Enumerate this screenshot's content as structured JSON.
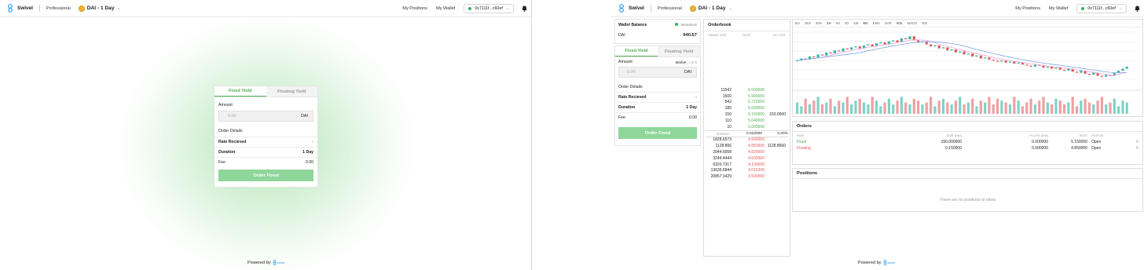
{
  "header": {
    "brand": "Swivel",
    "mode": "Professional",
    "pair": "DAI - 1 Day",
    "nav_positions": "My Positions",
    "nav_wallet": "My Wallet",
    "address": "0x7111f...c60ef"
  },
  "left_card": {
    "tab_fixed": "Fixed Yield",
    "tab_floating": "Floating Yield",
    "amount_label": "Amount",
    "amount_placeholder": "0.00",
    "amount_unit": "DAI",
    "order_details": "Order Details",
    "rate_label": "Rate Recieved",
    "rate_value": "-",
    "duration_label": "Duration",
    "duration_value": "1 Day",
    "fee_label": "Fee",
    "fee_value": "0.00",
    "button": "Order Fixed"
  },
  "powered_by": "Powered by",
  "powered_brand": "swivel",
  "wallet": {
    "title": "Wallet Balance",
    "provider": "MetaMask",
    "token": "DAI",
    "balance": "940.67"
  },
  "right_card": {
    "tab_fixed": "Fixed Yield",
    "tab_floating": "Floating Yield",
    "amount_label": "Amount",
    "market": "Market",
    "limit": "Limit",
    "amount_placeholder": "0.00",
    "amount_unit": "DAI",
    "order_details": "Order Details",
    "rate_label": "Rate Recieved",
    "rate_value": "-",
    "duration_label": "Duration",
    "duration_value": "1 Day",
    "fee_label": "Fee",
    "fee_value": "0.00",
    "button": "Order Fixed"
  },
  "orderbook": {
    "title": "Orderbook",
    "headers": [
      "TRADE SIZE",
      "RATE",
      "MY SIZE"
    ],
    "bids": [
      {
        "size": "11542",
        "rate": "6.500000",
        "mine": ""
      },
      {
        "size": "1500",
        "rate": "5.990000",
        "mine": ""
      },
      {
        "size": "842",
        "rate": "5.712000",
        "mine": ""
      },
      {
        "size": "185",
        "rate": "5.500000",
        "mine": ""
      },
      {
        "size": "150",
        "rate": "5.150000",
        "mine": "150.0000"
      },
      {
        "size": "110",
        "rate": "5.040000",
        "mine": ""
      },
      {
        "size": "10",
        "rate": "5.000000",
        "mine": ""
      }
    ],
    "spread_label": "SPREAD",
    "spread_value": "0.010000",
    "spread_pct": "0.20%",
    "asks": [
      {
        "size": "1828.6573",
        "rate": "4.990000",
        "mine": ""
      },
      {
        "size": "1128.866",
        "rate": "4.850000",
        "mine": "1128.8660"
      },
      {
        "size": "2044.6058",
        "rate": "4.820000",
        "mine": ""
      },
      {
        "size": "3244.4444",
        "rate": "4.500000",
        "mine": ""
      },
      {
        "size": "6320.7317",
        "rate": "4.100000",
        "mine": ""
      },
      {
        "size": "13635.6844",
        "rate": "4.015200",
        "mine": ""
      },
      {
        "size": "20857.1429",
        "rate": "3.500000",
        "mine": ""
      }
    ]
  },
  "chart": {
    "toolbar": [
      "5m",
      "15m",
      "30m",
      "1H",
      "4H",
      "1D",
      "1W",
      "MA",
      "EMA",
      "SAR",
      "VOL",
      "MACD",
      "RSI"
    ],
    "candles": [
      5.3,
      5.4,
      5.35,
      5.5,
      5.45,
      5.6,
      5.55,
      5.7,
      5.65,
      5.8,
      5.75,
      5.9,
      5.85,
      5.95,
      6.0,
      5.9,
      6.05,
      6.1,
      6.0,
      6.15,
      6.2,
      6.1,
      6.25,
      6.3,
      6.2,
      6.4,
      6.35,
      6.5,
      6.3,
      6.2,
      6.25,
      6.1,
      6.0,
      6.05,
      5.9,
      5.95,
      5.8,
      5.85,
      5.7,
      5.75,
      5.6,
      5.65,
      5.5,
      5.55,
      5.4,
      5.45,
      5.35,
      5.3,
      5.25,
      5.3,
      5.2,
      5.25,
      5.15,
      5.2,
      5.1,
      5.05,
      5.0,
      5.1,
      5.05,
      4.95,
      5.0,
      4.9,
      4.95,
      4.85,
      4.8,
      4.9,
      4.75,
      4.7,
      4.8,
      4.65,
      4.6,
      4.7,
      4.55,
      4.5,
      4.6,
      4.55,
      4.7,
      4.8,
      4.9,
      5.0
    ],
    "volumes": [
      0.6,
      0.4,
      0.8,
      0.5,
      0.7,
      0.9,
      0.5,
      0.6,
      0.8,
      0.4,
      0.7,
      0.6,
      0.9,
      0.5,
      0.7,
      0.8,
      0.6,
      0.5,
      0.9,
      0.7,
      0.4,
      0.6,
      0.8,
      0.5,
      0.7,
      0.9,
      0.6,
      0.5,
      0.8,
      0.7,
      0.5,
      0.6,
      0.9,
      0.4,
      0.7,
      0.8,
      0.6,
      0.5,
      0.7,
      0.9,
      0.5,
      0.6,
      0.8,
      0.4,
      0.7,
      0.6,
      0.9,
      0.5,
      0.8,
      0.7,
      0.6,
      0.5,
      0.9,
      0.7,
      0.4,
      0.6,
      0.8,
      0.5,
      0.7,
      0.9,
      0.6,
      0.5,
      0.8,
      0.7,
      0.5,
      0.6,
      0.9,
      0.4,
      0.7,
      0.8,
      0.6,
      0.5,
      0.7,
      0.9,
      0.5,
      0.6,
      0.8,
      0.4,
      0.7,
      0.6
    ]
  },
  "orders": {
    "title": "Orders",
    "headers": [
      "SIDE",
      "SIZE (DAI)",
      "FILLED (DAI)",
      "RATE",
      "STATUS"
    ],
    "rows": [
      {
        "side": "Fixed",
        "size": "150.000000",
        "filled": "0.000000",
        "rate": "5.150000",
        "status": "Open",
        "cancel": "X"
      },
      {
        "side": "Floating",
        "size": "0.150000",
        "filled": "0.000000",
        "rate": "4.850000",
        "status": "Open",
        "cancel": "X"
      }
    ]
  },
  "positions": {
    "title": "Positions",
    "empty": "There are no positions to show"
  },
  "colors": {
    "accent": "#4caf50",
    "button": "#8fd69b",
    "ask": "#e35959"
  }
}
